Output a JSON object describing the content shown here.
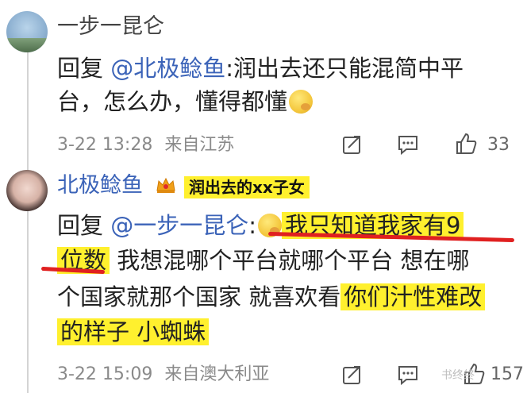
{
  "comment1": {
    "username": "一步一昆仑",
    "reply_prefix": "回复",
    "reply_to": "@北极鲶鱼",
    "line1_rest": ":润出去还只能混简中平",
    "line2": "台，怎么办，懂得都懂",
    "time": "3-22 13:28",
    "location": "来自江苏",
    "like_count": "33"
  },
  "comment2": {
    "username": "北极鲶鱼",
    "annotation": "润出去的xx子女",
    "reply_prefix": "回复",
    "reply_to": "@一步一昆仑",
    "colon": ":",
    "line1_hl": "我只知道我家有9",
    "line2_hl": "位数",
    "line2_rest": " 我想混哪个平台就哪个平台 想在哪",
    "line3_plain": "个国家就那个国家 就喜欢看",
    "line3_hl": "你们汁性难改",
    "line4_hl": "的样子 小蜘蛛",
    "time": "3-22 15:09",
    "location": "来自澳大利亚",
    "like_count": "157"
  },
  "watermark": "书终终"
}
